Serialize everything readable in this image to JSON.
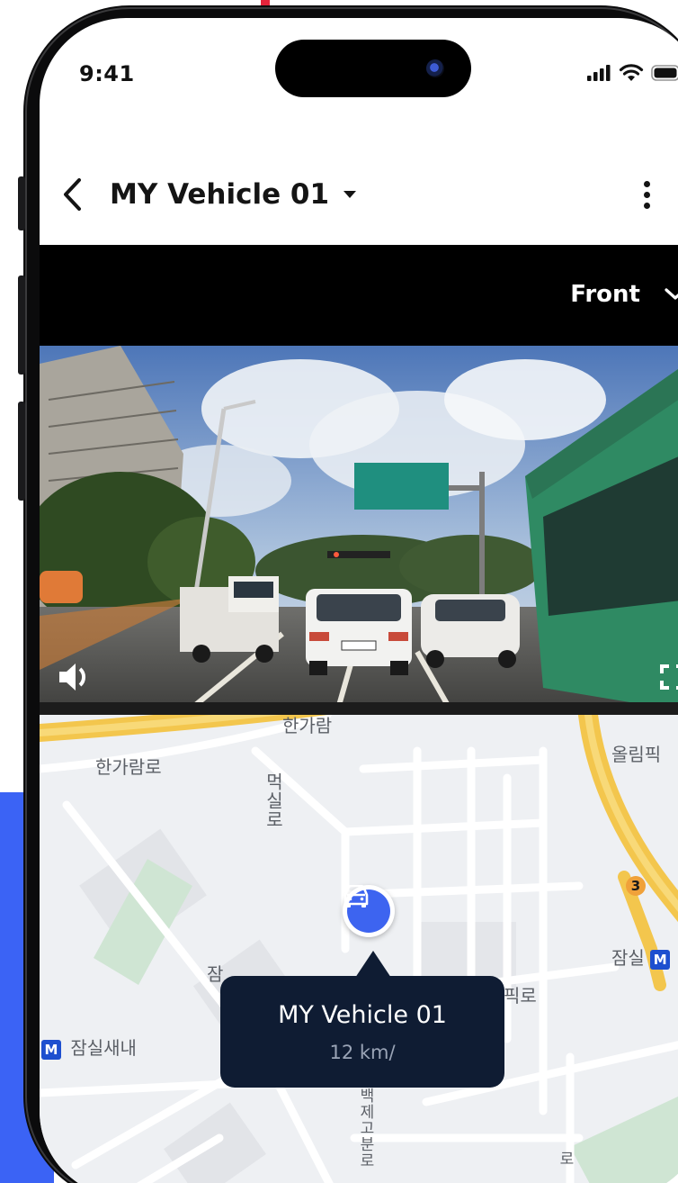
{
  "status_bar": {
    "time": "9:41"
  },
  "header": {
    "title": "MY Vehicle 01"
  },
  "camera": {
    "selected": "Front"
  },
  "map": {
    "labels": {
      "hangaram": "한가람로",
      "meoksal": "먹실로",
      "ollimpik": "올림픽",
      "jamsil": "잠실",
      "jamsil_metro": "M",
      "jamsil_saenae": "잠실새내",
      "saenae_metro": "M",
      "baekjegobun": "백제고분로",
      "line3": "3",
      "hangaram_top": "한가람",
      "jam": "잠",
      "bi_ro": "픽로",
      "bottom_road": "로"
    }
  },
  "vehicle_popup": {
    "name": "MY Vehicle 01",
    "speed": "12 km/"
  },
  "colors": {
    "accent": "#3d64f0",
    "popup_bg": "#0f1c33",
    "road_major": "#f3c64d",
    "park": "#cfe5d3"
  },
  "icons": {
    "back": "chevron-left-icon",
    "dropdown": "caret-down-icon",
    "more": "more-vertical-icon",
    "camera_toggle": "chevron-down-icon",
    "volume": "speaker-icon",
    "fullscreen": "fullscreen-icon",
    "vehicle": "car-icon",
    "signal": "cellular-signal-icon",
    "wifi": "wifi-icon",
    "battery": "battery-icon"
  }
}
